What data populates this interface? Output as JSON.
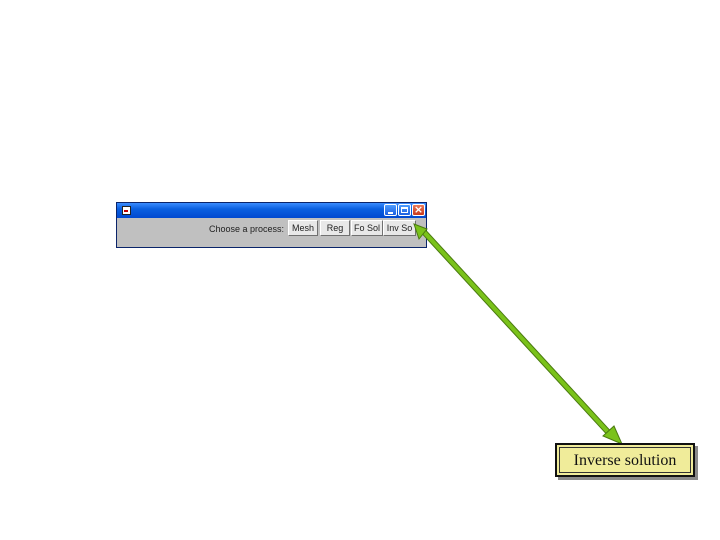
{
  "window": {
    "prompt": "Choose a process:",
    "buttons": {
      "mesh": "Mesh",
      "reg": "Reg",
      "fo_sol": "Fo Sol",
      "inv_sol": "Inv So"
    }
  },
  "callout": {
    "label": "Inverse solution"
  },
  "colors": {
    "arrow": "#7ac21a",
    "callout_fill": "#f0ec9a",
    "titlebar": "#0048d0"
  },
  "icons": [
    "app-icon",
    "minimize-icon",
    "maximize-icon",
    "close-icon",
    "arrow"
  ]
}
